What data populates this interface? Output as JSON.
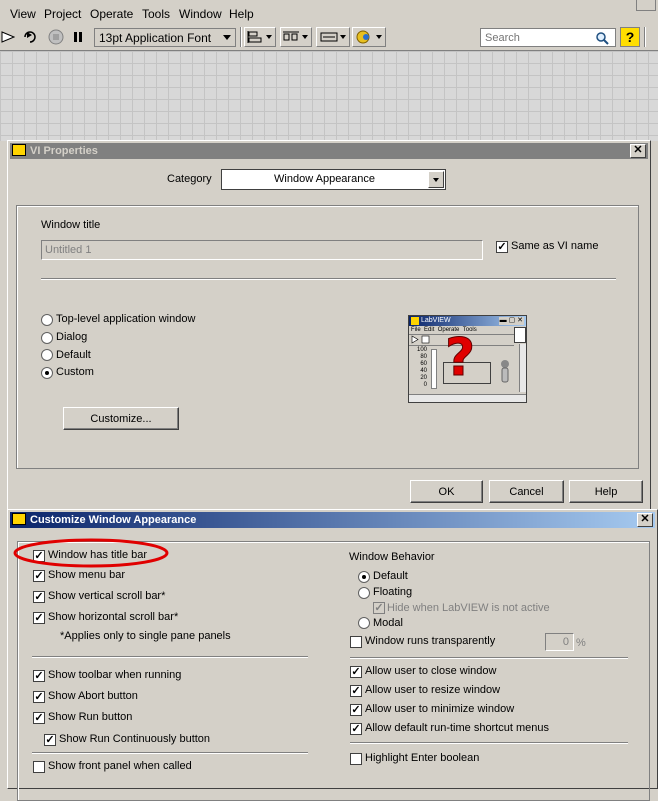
{
  "menubar": {
    "items": [
      "View",
      "Project",
      "Operate",
      "Tools",
      "Window",
      "Help"
    ]
  },
  "toolbar": {
    "font": "13pt Application Font",
    "search_placeholder": "Search"
  },
  "vi_properties": {
    "title": "VI Properties",
    "category_label": "Category",
    "category_value": "Window Appearance",
    "window_title_label": "Window title",
    "window_title_value": "Untitled 1",
    "same_as_vi_name": "Same as VI name",
    "radio_options": [
      "Top-level application window",
      "Dialog",
      "Default",
      "Custom"
    ],
    "selected_radio": "Custom",
    "customize_button": "Customize...",
    "ok_button": "OK",
    "cancel_button": "Cancel",
    "help_button": "Help",
    "preview": {
      "title": "LabVIEW",
      "menu": [
        "File",
        "Edit",
        "Operate",
        "Tools"
      ],
      "scale": [
        "100",
        "80",
        "60",
        "40",
        "20",
        "0"
      ],
      "question": "?"
    }
  },
  "customize": {
    "title": "Customize Window Appearance",
    "left_options": [
      {
        "label": "Window has title bar",
        "checked": true
      },
      {
        "label": "Show menu bar",
        "checked": true
      },
      {
        "label": "Show vertical scroll bar*",
        "checked": true
      },
      {
        "label": "Show horizontal scroll bar*",
        "checked": true
      }
    ],
    "note": "*Applies only to single pane panels",
    "run_options": [
      {
        "label": "Show toolbar when running",
        "checked": true
      },
      {
        "label": "Show Abort button",
        "checked": true
      },
      {
        "label": "Show Run button",
        "checked": true
      },
      {
        "label": "Show Run Continuously button",
        "checked": true
      }
    ],
    "front_panel_option": {
      "label": "Show front panel when called",
      "checked": false
    },
    "window_behavior_label": "Window Behavior",
    "behavior_options": [
      "Default",
      "Floating",
      "Modal"
    ],
    "selected_behavior": "Default",
    "hide_when_labview_inactive": "Hide when LabVIEW is not active",
    "transparent_label": "Window runs transparently",
    "transparency_value": "0",
    "transparency_unit": "%",
    "allow_options": [
      {
        "label": "Allow user to close window",
        "checked": true
      },
      {
        "label": "Allow user to resize window",
        "checked": true
      },
      {
        "label": "Allow user to minimize window",
        "checked": true
      },
      {
        "label": "Allow default run-time shortcut menus",
        "checked": true
      }
    ],
    "highlight_enter": {
      "label": "Highlight Enter boolean",
      "checked": false
    }
  },
  "colors": {
    "titlebar_start": "#0a246a",
    "titlebar_end": "#a6caf0",
    "inactive_title": "#808080",
    "highlight_circle": "#e00000",
    "help_icon": "#ffde00"
  }
}
